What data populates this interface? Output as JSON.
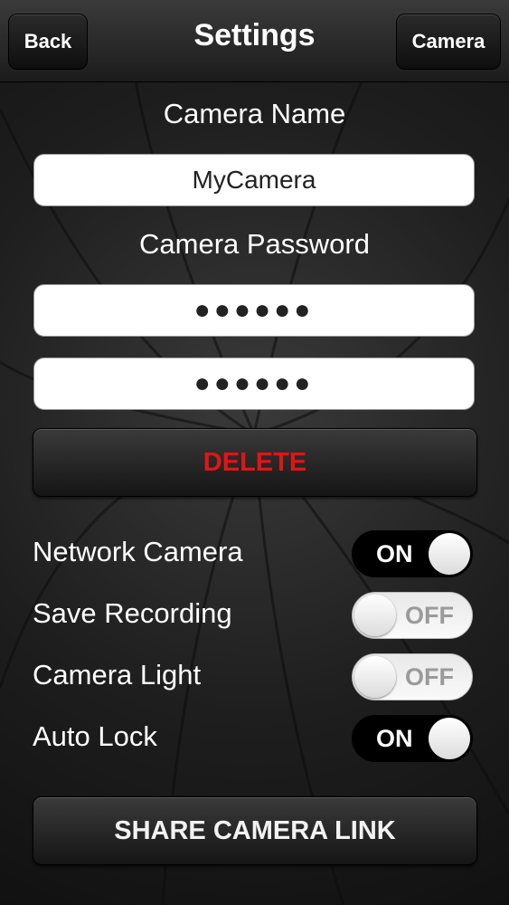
{
  "navbar": {
    "back_label": "Back",
    "title": "Settings",
    "camera_label": "Camera"
  },
  "camera_name": {
    "label": "Camera Name",
    "value": "MyCamera"
  },
  "camera_password": {
    "label": "Camera Password",
    "value": "●●●●●●",
    "confirm_value": "●●●●●●"
  },
  "delete_label": "DELETE",
  "toggles": [
    {
      "label": "Network Camera",
      "state": "ON"
    },
    {
      "label": "Save Recording",
      "state": "OFF"
    },
    {
      "label": "Camera Light",
      "state": "OFF"
    },
    {
      "label": "Auto Lock",
      "state": "ON"
    }
  ],
  "share_label": "SHARE CAMERA LINK",
  "colors": {
    "delete_text": "#e01515",
    "toggle_on_bg": "#000000",
    "toggle_off_bg": "#f2f2f2"
  }
}
